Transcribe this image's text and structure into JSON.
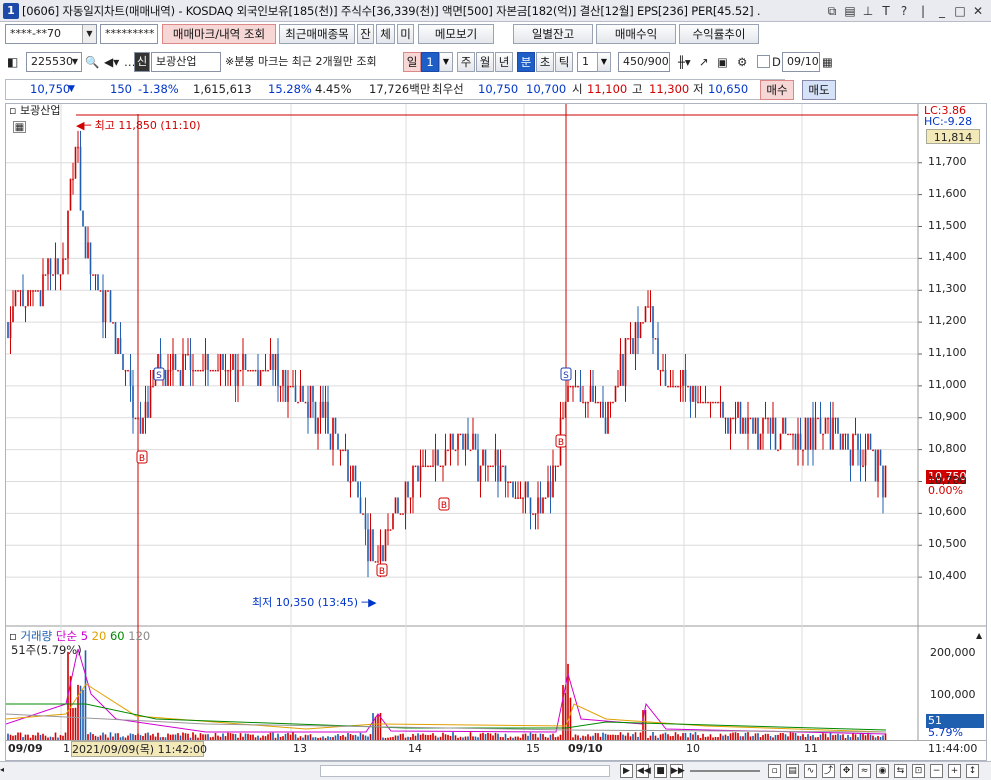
{
  "window": {
    "number": "1",
    "title": "[0606] 자동일지차트(매매내역) - KOSDAQ 외국인보유[185(천)] 주식수[36,339(천)] 액면[500] 자본금[182(억)] 결산[12월] EPS[236] PER[45.52] ."
  },
  "toolbar1": {
    "account": "****-**70",
    "password": "*********",
    "trade_mark_btn": "매매마크/내역 조회",
    "recent_items_btn": "최근매매종목",
    "tab_jan": "잔",
    "tab_che": "체",
    "tab_mi": "미",
    "memo_btn": "메모보기",
    "daily_balance_btn": "일별잔고",
    "trade_profit_btn": "매매수익",
    "return_trend_btn": "수익률추이"
  },
  "toolbar2": {
    "code": "225530",
    "sin": "신",
    "name": "보광산업",
    "notice": "※분봉 마크는 최근 2개월만 조회",
    "period_day": "일",
    "period_num": "1",
    "week": "주",
    "month": "월",
    "year": "년",
    "minute": "분",
    "second": "초",
    "tick": "틱",
    "tick_num": "1",
    "count": "450/900",
    "d_label": "D",
    "date": "09/10"
  },
  "quote": {
    "price": "10,750",
    "change": "150",
    "change_pct": "-1.38%",
    "volume": "1,615,613",
    "pct1": "15.28%",
    "pct2": "4.45%",
    "amount": "17,726백만",
    "best_label": "최우선",
    "ask": "10,750",
    "bid": "10,700",
    "open_label": "시",
    "open": "11,100",
    "high_label": "고",
    "high": "11,300",
    "low_label": "저",
    "low": "10,650",
    "buy_btn": "매수",
    "sell_btn": "매도"
  },
  "chart": {
    "stock_label": "보광산업",
    "lc": "LC:3.86",
    "hc": "HC:-9.28",
    "high_ann": "최고 11,850 (11:10)",
    "low_ann": "최저 10,350 (13:45)",
    "current_price": "10,750",
    "current_pct": "0.00%",
    "high_box": "11,814",
    "y_ticks": [
      "11,700",
      "11,600",
      "11,500",
      "11,400",
      "11,300",
      "11,200",
      "11,100",
      "11,000",
      "10,900",
      "10,800",
      "10,700",
      "10,600",
      "10,500",
      "10,400"
    ],
    "volume_label": "거래량",
    "ma_label": "단순",
    "ma_5": "5",
    "ma_20": "20",
    "ma_60": "60",
    "ma_120": "120",
    "vol_info": "51주(5.79%)",
    "vol_ticks": [
      "200,000",
      "100,000"
    ],
    "vol_current": "51",
    "vol_current_pct": "5.79%",
    "x_labels": [
      "09/09",
      "11",
      "13",
      "14",
      "15",
      "09/10",
      "10",
      "11"
    ],
    "cursor_time": "2021/09/09(목) 11:42:00",
    "right_time": "11:44:00",
    "colors": {
      "up": "#d10000",
      "down": "#1f5fb0",
      "ma5": "#d000d0",
      "ma20": "#e0a000",
      "ma60": "#008800",
      "ma120": "#999999",
      "grid": "#dcdcdc"
    }
  },
  "chart_data": {
    "type": "candlestick",
    "ylim": [
      10300,
      11900
    ],
    "trades": [
      {
        "type": "B",
        "time": "09/09 11:30"
      },
      {
        "type": "S",
        "time": "09/09 11:50"
      },
      {
        "type": "B",
        "time": "09/09 13:45"
      },
      {
        "type": "B",
        "time": "09/09 14:15"
      },
      {
        "type": "B",
        "time": "09/09 15:15"
      },
      {
        "type": "S",
        "time": "09/10 09:00"
      }
    ]
  }
}
